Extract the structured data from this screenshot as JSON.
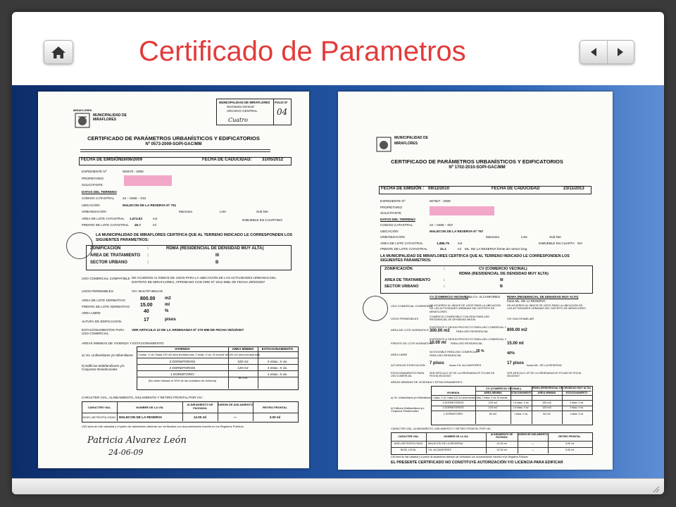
{
  "slide": {
    "title": "Certificado de Parametros",
    "icons": {
      "home": "home-icon",
      "prev": "arrow-left-icon",
      "next": "arrow-right-icon",
      "grip": "resize-grip-icon"
    },
    "colors": {
      "title": "#e23b3b",
      "band_dark": "#0d2d6a",
      "band_light": "#5e8ed4"
    }
  },
  "doc1": {
    "muni_top": "MIRAFLORES",
    "muni_name": "MUNICIPALIDAD DE",
    "muni_name2": "MIRAFLORES",
    "stamp_l1": "MUNICIPALIDAD DE MIRAFLORES",
    "stamp_l2": "Secretaria General",
    "stamp_l3": "ARCHIVO CENTRAL",
    "folio_label": "FOLIO Nº",
    "folio_value": "04",
    "heading": "CERTIFICADO DE PARÁMETROS URBANÍSTICOS Y EDIFICATORIOS",
    "number": "Nº 0573-2009-SOPI-GAC/MM",
    "fecha_emision_label": "FECHA DE EMISIÓN:",
    "fecha_emision": "16/06/2009",
    "fecha_caducidad_label": "FECHA DE CADUCIDAD:",
    "fecha_caducidad": "31/05/2012",
    "expediente_label": "EXPEDIENTE Nº",
    "expediente": "004070 - 2009",
    "propietario_label": "PROPIETARIO",
    "solicitante_label": "SOLICITANTE",
    "datos_terreno": "DATOS DEL TERRENO",
    "codigo_catastral_label": "CODIGO CATASTRAL",
    "codigo_catastral": "22 – 0466 – 010",
    "ubicacion_label": "UBICACIÓN",
    "ubicacion": "MALECON DE LA RESERVA Nº 751",
    "urbanizacion_label": "URBANIZACION",
    "manzana_label": "Manzana",
    "lote_label": "Lote",
    "sublote_label": "Sub lote",
    "area_label": "AREA DE LOTE CATASTRAL",
    "area": "1,574.63",
    "area_unit": "m2",
    "frente_label": "FRENTE DE LOTE CATASTRAL",
    "frente": "26.7",
    "frente_unit": "ml",
    "inmueble_label": "INMUEBLE EN CUARTA",
    "inmueble_value": "NO",
    "certifica_text": "LA MUNICIPALIDAD DE MIRAFLORES CERTIFICA QUE AL TERRENO INDICADO LE CORRESPONDEN LOS SIGUIENTES PARAMETROS:",
    "zonificacion_label": "ZONIFICACIÓN",
    "zonificacion": "RDMA (RESIDENCIAL DE DENSIDAD MUY ALTA)",
    "area_tratamiento_label": "AREA DE TRATAMIENTO",
    "area_tratamiento": "III",
    "sector_label": "SECTOR URBANO",
    "sector": "B",
    "uso_compatible_label": "USO COMERCIAL COMPATIBLE",
    "uso_compatible": "DE ACUERDO AL ÍNDICE DE USOS PARA LA UBICACIÓN DE LAS ACTIVIDADES URBANAS DEL DISTRITO DE MIRAFLORES, APROBADO CON ORD Nº 1012-MML DE FECHA 29/04/2007",
    "usos_permisibles_label": "USOS PERMISIBLES",
    "usos_permisibles": "VIV. MULTIFAMILIAR",
    "area_normativo_label": "AREA DE LOTE NORMATIVO",
    "area_normativo": "800.00",
    "area_normativo_unit": "m2",
    "frente_normativo_label": "FRENTE DE LOTE NORMATIVO",
    "frente_normativo": "15.00",
    "frente_normativo_unit": "ml",
    "area_libre_label": "AREA LIBRE",
    "area_libre": "40",
    "area_libre_unit": "%",
    "altura_label": "ALTURA DE EDIFICACION",
    "altura": "17",
    "altura_unit": "pisos",
    "estacionamientos_label": "ESTACIONAMIENTOS PARA USO COMERCIAL",
    "estacionamientos": "VER ARTICULO 10 DE LA ORDENANZA Nº 270-MM DE FECHA 05/10/2007",
    "areas_minimas_title": "AREAS MINIMAS DE VIVIENDA Y ESTACIONAMIENTO:",
    "viv_table_headers": [
      "VIVIENDA",
      "AREA MÍNIMA",
      "ESTACIONAMIENTO"
    ],
    "viv_rows": [
      {
        "label": "a) Viv. Unifamiliares y/o Bifamiliares",
        "vivienda": "1 estac. X viv. Hasta 120 m2 area techada total, 2 estac. X viv. Si excede de 120 m2 area techada total",
        "area": "",
        "estac": ""
      },
      {
        "label": "b) Edificios Multifamiliares y/o Conjuntos Residenciales",
        "vivienda": "3 DORMITORIOS",
        "area": "100 m2",
        "estac": "2 estac. X viv."
      },
      {
        "label": "",
        "vivienda": "2 DORMITORIOS",
        "area": "120 m2",
        "estac": "2 estac. X viv."
      },
      {
        "label": "",
        "vivienda": "1 DORMITORIO",
        "area": "",
        "estac": "1 estac. X viv."
      },
      {
        "label": "",
        "vivienda": "(No debe rebasar el 30% de las unidades de vivienda)",
        "area": "60 m2",
        "estac": ""
      }
    ],
    "vial_title": "CARACTER VIAL, ALINEAMIENTO, AISLAMIENTO Y RETIRO FRONTAL POR VIA :",
    "vial_headers": [
      "CARACTER VIAL",
      "NOMBRE DE LA VIA",
      "ALINEAMIENTO DE FACHADA",
      "JARDIN DE AISLAMIENTO",
      "RETIRO FRONTAL"
    ],
    "vial_row": [
      "NIVEL METROPOLITANO",
      "MALECON DE LA RESERVA",
      "12.00 ml",
      "---",
      "3.00 ml"
    ],
    "note": "(*)El área de lote catastral y el jardín de aislamiento deberán ser verificados con documentación inscrita en los Registros Públicos",
    "signature": "Patricia Alvarez León",
    "signature_date": "24-06-09",
    "handwritten_top": "Cuatro"
  },
  "doc2": {
    "muni_name": "MUNICIPALIDAD DE",
    "muni_name2": "MIRAFLORES",
    "heading": "CERTIFICADO DE PARÁMETROS URBANÍSTICOS Y EDIFICATORIOS",
    "number": "Nº 1702-2010-SOPI-GAC/MM",
    "fecha_emision_label": "FECHA DE EMISIÓN :",
    "fecha_emision": "09/12/2010",
    "fecha_caducidad_label": "FECHA DE CADUCIDAD",
    "fecha_caducidad": "23/11/2013",
    "expediente_label": "EXPEDIENTE Nº",
    "expediente": "007827 - 2009",
    "propietario_label": "PROPIETARIO",
    "solicitante_label": "SOLICITANTE",
    "datos_terreno": "DATOS DEL TERRENO",
    "codigo_catastral_label": "CODIGO CATASTRAL",
    "codigo_catastral": "22 – 0466 – 007",
    "ubicacion_label": "UBICACIÓN",
    "ubicacion": "MALECON DE LA RESERVA Nº 767",
    "urbanizacion_label": "URBANIZACION",
    "manzana_label": "Manzana",
    "lote_label": "Lote",
    "sublote_label": "Sub lote",
    "area_label": "AREA DE LOTE CATASTRAL",
    "area": "1,886.75",
    "area_unit": "m2",
    "inmueble_label": "INMUEBLE EN CUARTA",
    "inmueble_value": "NO",
    "frente_label": "FRENTE DE LOTE CATASTRAL",
    "frente": "21.1",
    "frente_unit": "ml",
    "frente_note": "ML. DE LA RESERVA frente de menor long.",
    "certifica_text": "LA MUNICIPALIDAD DE MIRAFLORES CERTIFICA QUE AL TERRENO INDICADO LE CORRESPONDEN LOS SIGUIENTES PARAMETROS:",
    "zonificacion_label": "ZONIFICACIÓN",
    "zonificacion_1": "CV (COMERCIO VECINAL)",
    "zonificacion_2": "RDMA (RESIDENCIAL DE DENSIDAD MUY ALTA)",
    "area_tratamiento_label": "AREA DE TRATAMIENTO",
    "area_tratamiento": "III",
    "sector_label": "SECTOR URBANO",
    "sector": "B",
    "col_cv": "CV (COMERCIO VECINAL)",
    "col_cv_sub": "hasta CA. ALCANFORES",
    "col_rdma": "RDMA (RESIDENCIAL DE DENSIDAD MUY ALTA)",
    "col_rdma_sub": "hacia ML. DE LA RESERVA",
    "uso_compatible_label": "USO COMERCIAL COMPATIBLE",
    "uso_cv": "DE ACUERDO AL ÍNDICE DE USOS PARA LA UBICACIÓN DE LAS ACTIVIDADES URBANAS DEL DISTRITO DE MIRAFLORES",
    "uso_rdma": "DE ACUERDO AL ÍNDICE DE USOS PARA LA UBICACIÓN DE LAS ACTIVIDADES URBANAS DEL DISTRITO DE MIRAFLORES",
    "usos_permisibles_label": "USOS PERMISIBLES",
    "usos_cv": "COMERCIO COMPATIBLE CON RDM PARA USO RESIDENCIAL DE DENSIDAD MEDIA",
    "usos_rdma": "VIV. MULTIFAMILIAR",
    "area_normativo_label": "AREA DE LOTE NORMATIVO",
    "area_cv_note": "EXISTENTE O SEGUN PROYECTO PARA USO COMERCIAL Y",
    "area_cv": "300.00 m2",
    "area_cv_tail": "PARA USO RESIDENCIAL",
    "area_rdma": "800.00 m2",
    "frente_normativo_label": "FRENTE DE LOTE NORMATIVO",
    "frente_cv_note": "EXISTENTE O SEGUN PROYECTO PARA USO COMERCIAL Y",
    "frente_cv": "10.00 ml",
    "frente_cv_tail": "PARA USO RESIDENCIAL",
    "frente_rdma": "15.00 ml",
    "area_libre_label": "AREA LIBRE",
    "area_libre_cv": "NO EXIGIBLE PARA USO COMERCIAL -",
    "area_libre_cv_pct": "35 %",
    "area_libre_cv_tail": "PARA USO RESIDENCIAL",
    "area_libre_rdma": "40%",
    "altura_label": "ALTURA DE EDIFICACION",
    "altura_cv": "7 pisos",
    "altura_cv_tail": "hacia CA. ALCANFORES",
    "altura_rdma": "17 pisos",
    "altura_rdma_tail": "hacia ML. DE LA RESERVA",
    "estacionamientos_label": "ESTACIONAMIENTOS PARA USO COMERCIAL",
    "estac_cv": "VER ARTICULO 10º DE LA ORDENANZA Nº 270-MM DE FECHA 05/10/2007",
    "estac_rdma": "VER ARTICULO 10º DE LA ORDENANZA Nº 270-MM DE FECHA 05/10/2007",
    "areas_minimas_title": "AREAS MINIMAS DE VIVIENDA Y ESTACIONAMIENTO :",
    "table_cv": "CV (COMERCIO VECINAL)",
    "table_rdma": "RDMA (RESIDENCIAL DE DENSIDAD MUY ALTA)",
    "table_headers": [
      "VIVIENDA",
      "AREA MÍNIMA",
      "ESTACIONAMIENTO",
      "AREA MÍNIMA",
      "ESTACIONAMIENTO"
    ],
    "table_row_a": "1 estac. X viv. Hasta 120 m2 area techada total, 2 estac. X viv. Si excede",
    "rows": [
      {
        "v": "3 DORMITORIOS",
        "a1": "120 m2",
        "e1": "1.5 estac. X viv.",
        "a2": "150 m2",
        "e2": "2 estac. X viv."
      },
      {
        "v": "2 DORMITORIOS",
        "a1": "120 m2",
        "e1": "1.5 estac. X viv.",
        "a2": "120 m2",
        "e2": "2 estac. X viv."
      },
      {
        "v": "1 DORMITORIO",
        "a1": "60 m2",
        "e1": "1 estac. X viv.",
        "a2": "60 m2",
        "e2": "1 estac. X viv."
      }
    ],
    "row_label_a": "a) Viv. Unifamiliares y/o Bifamiliares",
    "row_label_b": "b) Edificios Multifamiliares y/o Conjuntos Residenciales",
    "vial_title": "CARACTER VIAL, ALINEAMIENTO, AISLAMIENTO Y RETIRO FRONTAL POR VIA :",
    "vial_headers": [
      "CARACTER VIAL",
      "NOMBRE DE LA VIA",
      "ALINEAMIENTO DE FACHADA",
      "JARDIN DE AISLAMIENTO",
      "RETIRO FRONTAL"
    ],
    "vial_rows": [
      [
        "NIVEL METROPOLITANO",
        "MALECON DE LA RESERVA",
        "12.00 ml",
        "---",
        "3.00 ml"
      ],
      [
        "NIVEL LOCAL",
        "CA. ALCANFORES",
        "12.00 ml",
        "---",
        "3.00 ml"
      ]
    ],
    "note": "(*)El área de lote catastral y el jardín de aislamiento deberán ser verificados con documentación inscrita en los Registros Públicos",
    "footer": "EL PRESENTE CERTIFICADO NO CONSTITUYE AUTORIZACIÓN Y/O LICENCIA PARA EDIFICAR"
  }
}
